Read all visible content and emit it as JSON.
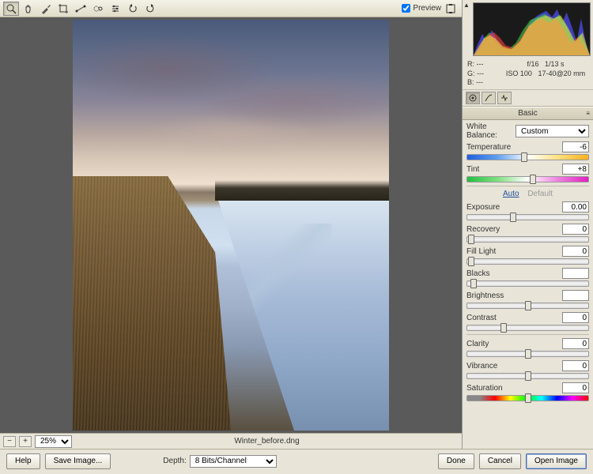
{
  "toolbar": {
    "preview_label": "Preview",
    "preview_checked": true
  },
  "filename": "Winter_before.dng",
  "zoom": {
    "value": "25%"
  },
  "depth": {
    "label": "Depth:",
    "value": "8 Bits/Channel"
  },
  "metadata": {
    "r": "R: ---",
    "g": "G: ---",
    "b": "B: ---",
    "aperture": "f/16",
    "shutter": "1/13 s",
    "iso": "ISO 100",
    "lens": "17-40@20 mm"
  },
  "panel": {
    "title": "Basic",
    "white_balance": {
      "label": "White Balance:",
      "value": "Custom"
    },
    "auto": "Auto",
    "default": "Default",
    "sliders": {
      "temperature": {
        "label": "Temperature",
        "value": "-6",
        "pos": 47
      },
      "tint": {
        "label": "Tint",
        "value": "+8",
        "pos": 54
      },
      "exposure": {
        "label": "Exposure",
        "value": "0.00",
        "pos": 38
      },
      "recovery": {
        "label": "Recovery",
        "value": "0",
        "pos": 3
      },
      "fill_light": {
        "label": "Fill Light",
        "value": "0",
        "pos": 3
      },
      "blacks": {
        "label": "Blacks",
        "value": "",
        "pos": 5
      },
      "brightness": {
        "label": "Brightness",
        "value": "",
        "pos": 50
      },
      "contrast": {
        "label": "Contrast",
        "value": "0",
        "pos": 30
      },
      "clarity": {
        "label": "Clarity",
        "value": "0",
        "pos": 50
      },
      "vibrance": {
        "label": "Vibrance",
        "value": "0",
        "pos": 50
      },
      "saturation": {
        "label": "Saturation",
        "value": "0",
        "pos": 50
      }
    }
  },
  "buttons": {
    "help": "Help",
    "save_image": "Save Image...",
    "done": "Done",
    "cancel": "Cancel",
    "open_image": "Open Image"
  }
}
